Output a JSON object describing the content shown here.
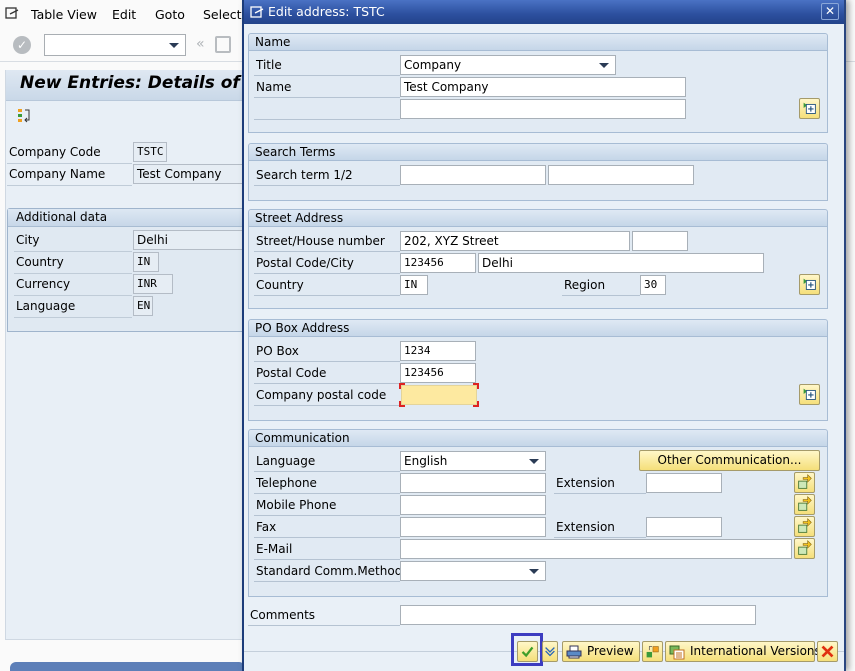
{
  "menubar": {
    "icon": "menu-icon",
    "items": [
      "Table View",
      "Edit",
      "Goto",
      "Selection"
    ]
  },
  "toolbar": {
    "command_field_value": "",
    "icons": [
      "enter-check-icon",
      "back-icon",
      "save-icon"
    ]
  },
  "background": {
    "title": "New Entries: Details of Added Entries",
    "fields": [
      {
        "label": "Company Code",
        "value": "TSTC"
      },
      {
        "label": "Company Name",
        "value": "Test Company"
      }
    ],
    "additional_data": {
      "title": "Additional data",
      "fields": [
        {
          "label": "City",
          "value": "Delhi"
        },
        {
          "label": "Country",
          "value": "IN"
        },
        {
          "label": "Currency",
          "value": "INR"
        },
        {
          "label": "Language",
          "value": "EN"
        }
      ]
    }
  },
  "dialog": {
    "title": "Edit address:  TSTC",
    "close_label": "✕",
    "name_group": {
      "title": "Name",
      "title_label": "Title",
      "title_value": "Company",
      "name_label": "Name",
      "name_value": "Test Company",
      "name2_value": ""
    },
    "search_group": {
      "title": "Search Terms",
      "label": "Search term 1/2",
      "term1": "",
      "term2": ""
    },
    "street_group": {
      "title": "Street Address",
      "street_label": "Street/House number",
      "street_value": "202, XYZ Street",
      "house_value": "",
      "postal_label": "Postal Code/City",
      "postal_value": "123456",
      "city_value": "Delhi",
      "country_label": "Country",
      "country_value": "IN",
      "region_label": "Region",
      "region_value": "30"
    },
    "pobox_group": {
      "title": "PO Box Address",
      "pobox_label": "PO Box",
      "pobox_value": "1234",
      "postal_label": "Postal Code",
      "postal_value": "123456",
      "company_postal_label": "Company postal code",
      "company_postal_value": ""
    },
    "comm_group": {
      "title": "Communication",
      "language_label": "Language",
      "language_value": "English",
      "other_comm_button": "Other Communication...",
      "telephone_label": "Telephone",
      "telephone_value": "",
      "extension_label": "Extension",
      "tel_extension_value": "",
      "mobile_label": "Mobile Phone",
      "mobile_value": "",
      "fax_label": "Fax",
      "fax_value": "",
      "fax_extension_label": "Extension",
      "fax_extension_value": "",
      "email_label": "E-Mail",
      "email_value": "",
      "std_method_label": "Standard Comm.Method",
      "std_method_value": ""
    },
    "comments_label": "Comments",
    "comments_value": "",
    "footer": {
      "preview_label": "Preview",
      "intl_versions_label": "International Versions"
    }
  },
  "colors": {
    "title_bar": "#2c4f9e",
    "focus_box": "#3c3cc0",
    "required_field": "#fde9a0",
    "button_yellow": "#f5df7a"
  }
}
